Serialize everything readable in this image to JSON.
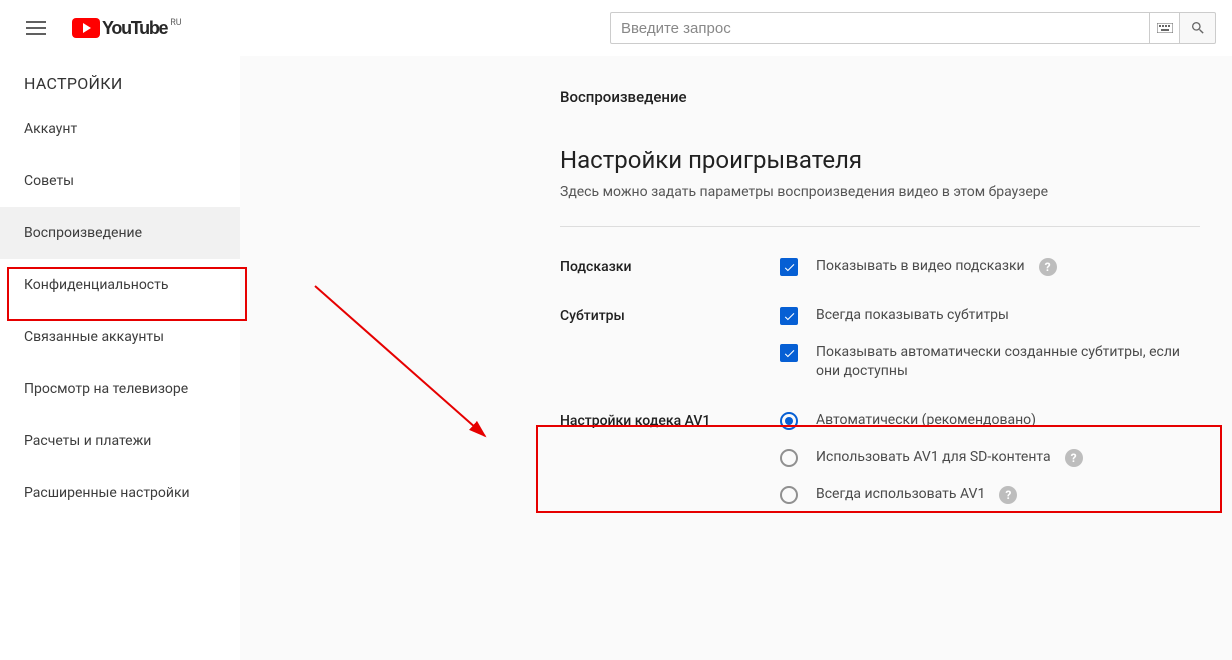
{
  "header": {
    "logo_text": "YouTube",
    "logo_region": "RU",
    "search_placeholder": "Введите запрос"
  },
  "sidebar": {
    "title": "НАСТРОЙКИ",
    "items": [
      {
        "label": "Аккаунт"
      },
      {
        "label": "Советы"
      },
      {
        "label": "Воспроизведение",
        "active": true
      },
      {
        "label": "Конфиденциальность"
      },
      {
        "label": "Связанные аккаунты"
      },
      {
        "label": "Просмотр на телевизоре"
      },
      {
        "label": "Расчеты и платежи"
      },
      {
        "label": "Расширенные настройки"
      }
    ]
  },
  "main": {
    "breadcrumb": "Воспроизведение",
    "heading": "Настройки проигрывателя",
    "description": "Здесь можно задать параметры воспроизведения видео в этом браузере",
    "sections": {
      "hints": {
        "label": "Подсказки",
        "opt1": "Показывать в видео подсказки"
      },
      "subtitles": {
        "label": "Субтитры",
        "opt1": "Всегда показывать субтитры",
        "opt2": "Показывать автоматически созданные субтитры, если они доступны"
      },
      "av1": {
        "label": "Настройки кодека AV1",
        "opt1": "Автоматически (рекомендовано)",
        "opt2": "Использовать AV1 для SD-контента",
        "opt3": "Всегда использовать AV1"
      }
    }
  },
  "colors": {
    "accent": "#065fd4",
    "highlight": "#e60000"
  }
}
